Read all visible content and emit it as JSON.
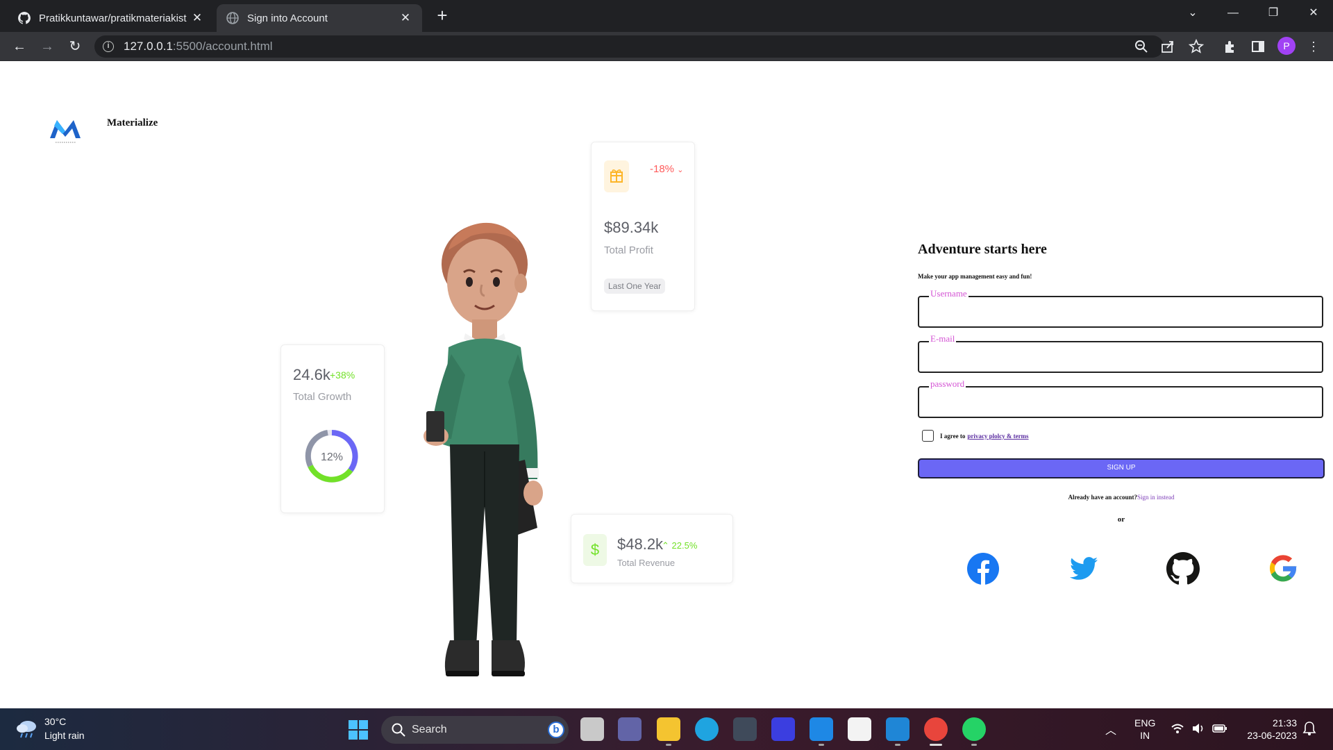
{
  "browser": {
    "tabs": [
      {
        "title": "Pratikkuntawar/pratikmateriakist",
        "active": false,
        "favicon": "github-icon"
      },
      {
        "title": "Sign into Account",
        "active": true,
        "favicon": "globe-icon"
      }
    ],
    "url_host": "127.0.0.1",
    "url_path": ":5500/account.html",
    "profile_initial": "P"
  },
  "brand": {
    "name": "Materialize"
  },
  "cards": {
    "profit": {
      "change": "-18%",
      "value": "$89.34k",
      "label": "Total Profit",
      "chip": "Last One Year"
    },
    "growth": {
      "value": "24.6k",
      "change": "+38%",
      "label": "Total Growth",
      "donut_label": "12%",
      "donut_percent": 12
    },
    "revenue": {
      "symbol": "$",
      "value": "$48.2k",
      "change": "22.5%",
      "label": "Total Revenue"
    }
  },
  "form": {
    "title": "Adventure starts here",
    "subtitle": "Make your app management easy and fun!",
    "username_label": "Username",
    "email_label": "E-mail",
    "password_label": "password",
    "agree_prefix": "I agree to",
    "agree_link": "privacy plolcy & terms",
    "signup_label": "SIGN UP",
    "have_account": "Already have an account?",
    "signin_link": "Sign in instead",
    "or": "or"
  },
  "social": [
    "facebook-icon",
    "twitter-icon",
    "github-icon",
    "google-icon"
  ],
  "colors": {
    "accent": "#6b67f5",
    "label": "#d454d4",
    "profit_down": "#ff5b5b",
    "growth_up": "#72e128"
  },
  "taskbar": {
    "weather_temp": "30°C",
    "weather_desc": "Light rain",
    "search_placeholder": "Search",
    "lang_line1": "ENG",
    "lang_line2": "IN",
    "time": "21:33",
    "date": "23-06-2023"
  }
}
